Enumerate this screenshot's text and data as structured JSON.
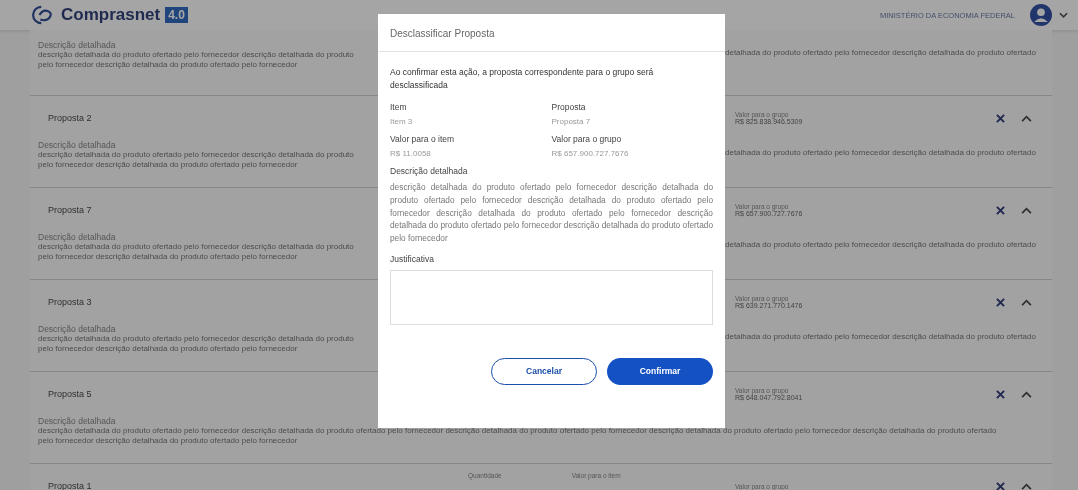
{
  "header": {
    "logo": "Comprasnet",
    "version": "4.0",
    "organization": "MINISTÉRIO DA ECONOMIA FEDERAL"
  },
  "proposals": [
    {
      "desc_label": "Descrição detalhada",
      "desc_left": [
        "descrição detalhada do produto ofertado pelo fornecedor descrição detalhada do produto",
        "pelo fornecedor descrição detalhada do produto ofertado pelo fornecedor"
      ],
      "desc_right": "detalhada do produto ofertado pelo fornecedor descrição detalhada do produto ofertado"
    },
    {
      "title": "Proposta 2",
      "value_label": "Valor para o grupo",
      "value": "R$ 825.838.946.5309",
      "desc_label": "Descrição detalhada",
      "desc_left": [
        "descrição detalhada do produto ofertado pelo fornecedor descrição detalhada do produto",
        "pelo fornecedor descrição detalhada do produto ofertado pelo fornecedor"
      ],
      "desc_right": "detalhada do produto ofertado pelo fornecedor descrição detalhada do produto ofertado"
    },
    {
      "title": "Proposta 7",
      "value_label": "Valor para o grupo",
      "value": "R$ 657.900.727.7676",
      "desc_label": "Descrição detalhada",
      "desc_left": [
        "descrição detalhada do produto ofertado pelo fornecedor descrição detalhada do produto",
        "pelo fornecedor descrição detalhada do produto ofertado pelo fornecedor"
      ],
      "desc_right": "detalhada do produto ofertado pelo fornecedor descrição detalhada do produto ofertado"
    },
    {
      "title": "Proposta 3",
      "value_label": "Valor para o grupo",
      "value": "R$ 639.271.770.1476",
      "desc_label": "Descrição detalhada",
      "desc_left": [
        "descrição detalhada do produto ofertado pelo fornecedor descrição detalhada do produto",
        "pelo fornecedor descrição detalhada do produto ofertado pelo fornecedor"
      ],
      "desc_right": "detalhada do produto ofertado pelo fornecedor descrição detalhada do produto ofertado"
    },
    {
      "title": "Proposta 5",
      "value_label": "Valor para o grupo",
      "value": "R$ 648.047.792.8041",
      "desc_label": "Descrição detalhada",
      "desc_left": [
        "descrição detalhada do produto ofertado pelo fornecedor descrição detalhada do produto ofertado pelo fornecedor descrição detalhada do produto ofertado pelo fornecedor descrição detalhada do produto ofertado pelo fornecedor descrição detalhada do produto ofertado",
        "pelo fornecedor descrição detalhada do produto ofertado pelo fornecedor"
      ]
    },
    {
      "title": "Proposta 1",
      "middle_labels": [
        "Quantidade",
        "Valor para o item"
      ],
      "value_label": "Valor para o grupo"
    }
  ],
  "modal": {
    "title": "Desclassificar Proposta",
    "message": "Ao confirmar esta ação, a proposta correspondente para o grupo será desclassificada",
    "fields": [
      {
        "label": "Item",
        "value": "Item 3"
      },
      {
        "label": "Proposta",
        "value": "Proposta 7"
      },
      {
        "label": "Valor para o item",
        "value": "R$ 11.0058"
      },
      {
        "label": "Valor para o grupo",
        "value": "R$ 657.900.727.7676"
      }
    ],
    "desc_label": "Descrição detalhada",
    "description": "descrição detalhada do produto ofertado pelo fornecedor descrição detalhada do produto ofertado pelo fornecedor descrição detalhada do produto ofertado pelo fornecedor descrição detalhada do produto ofertado pelo fornecedor descrição detalhada do produto ofertado pelo fornecedor descrição detalhada do produto ofertado pelo fornecedor",
    "justification_label": "Justificativa",
    "cancel": "Cancelar",
    "confirm": "Confirmar"
  }
}
